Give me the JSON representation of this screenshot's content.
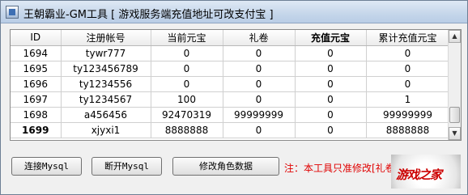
{
  "window": {
    "title": "王朝霸业-GM工具 [ 游戏服务端充值地址可改支付宝 ]"
  },
  "grid": {
    "columns": [
      "ID",
      "注册帐号",
      "当前元宝",
      "礼卷",
      "充值元宝",
      "累计充值元宝"
    ],
    "rows": [
      [
        "1694",
        "tywr777",
        "0",
        "0",
        "0",
        "0"
      ],
      [
        "1695",
        "ty123456789",
        "0",
        "0",
        "0",
        "0"
      ],
      [
        "1696",
        "ty1234556",
        "0",
        "0",
        "0",
        "0"
      ],
      [
        "1697",
        "ty1234567",
        "100",
        "0",
        "0",
        "1"
      ],
      [
        "1698",
        "a456456",
        "92470319",
        "99999999",
        "0",
        "99999999"
      ],
      [
        "1699",
        "xjyxi1",
        "8888888",
        "0",
        "0",
        "8888888"
      ]
    ]
  },
  "buttons": {
    "connect": "连接Mysql",
    "disconnect": "断开Mysql",
    "modify": "修改角色数据"
  },
  "notice": "注：本工具只准修改[礼卷",
  "logo": {
    "text": "游戏之家"
  },
  "colors": {
    "notice": "#e00000",
    "logo": "#cc0000"
  }
}
